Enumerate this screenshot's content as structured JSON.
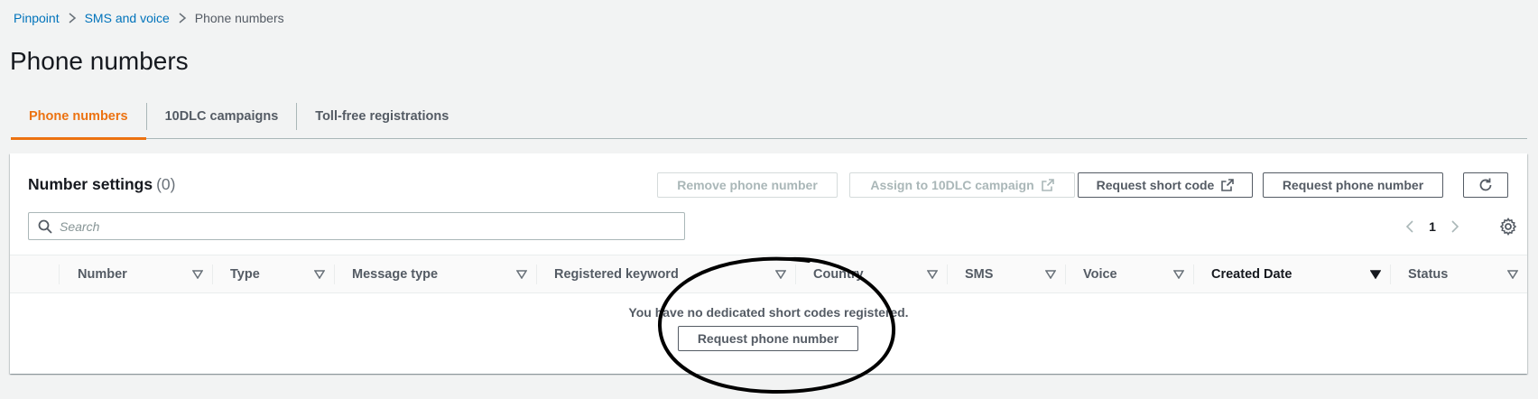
{
  "breadcrumb": {
    "items": [
      {
        "label": "Pinpoint"
      },
      {
        "label": "SMS and voice"
      },
      {
        "label": "Phone numbers"
      }
    ]
  },
  "page": {
    "title": "Phone numbers"
  },
  "tabs": [
    {
      "label": "Phone numbers",
      "active": true
    },
    {
      "label": "10DLC campaigns",
      "active": false
    },
    {
      "label": "Toll-free registrations",
      "active": false
    }
  ],
  "panel": {
    "title": "Number settings",
    "count": "(0)",
    "actions": {
      "remove": "Remove phone number",
      "assign": "Assign to 10DLC campaign",
      "short_code": "Request short code",
      "request_number": "Request phone number"
    },
    "refresh_icon": "refresh-icon",
    "search": {
      "placeholder": "Search",
      "value": ""
    },
    "pagination": {
      "current_page": "1"
    },
    "settings_icon": "gear-icon"
  },
  "table": {
    "columns": [
      {
        "label": "Number"
      },
      {
        "label": "Type"
      },
      {
        "label": "Message type"
      },
      {
        "label": "Registered keyword"
      },
      {
        "label": "Country"
      },
      {
        "label": "SMS"
      },
      {
        "label": "Voice"
      },
      {
        "label": "Created Date",
        "sorted": "descending"
      },
      {
        "label": "Status"
      }
    ],
    "empty": {
      "message": "You have no dedicated short codes registered.",
      "action": "Request phone number"
    }
  },
  "colors": {
    "accent_tab": "#ec7211",
    "link": "#0073bb",
    "annotation": "#000000"
  }
}
